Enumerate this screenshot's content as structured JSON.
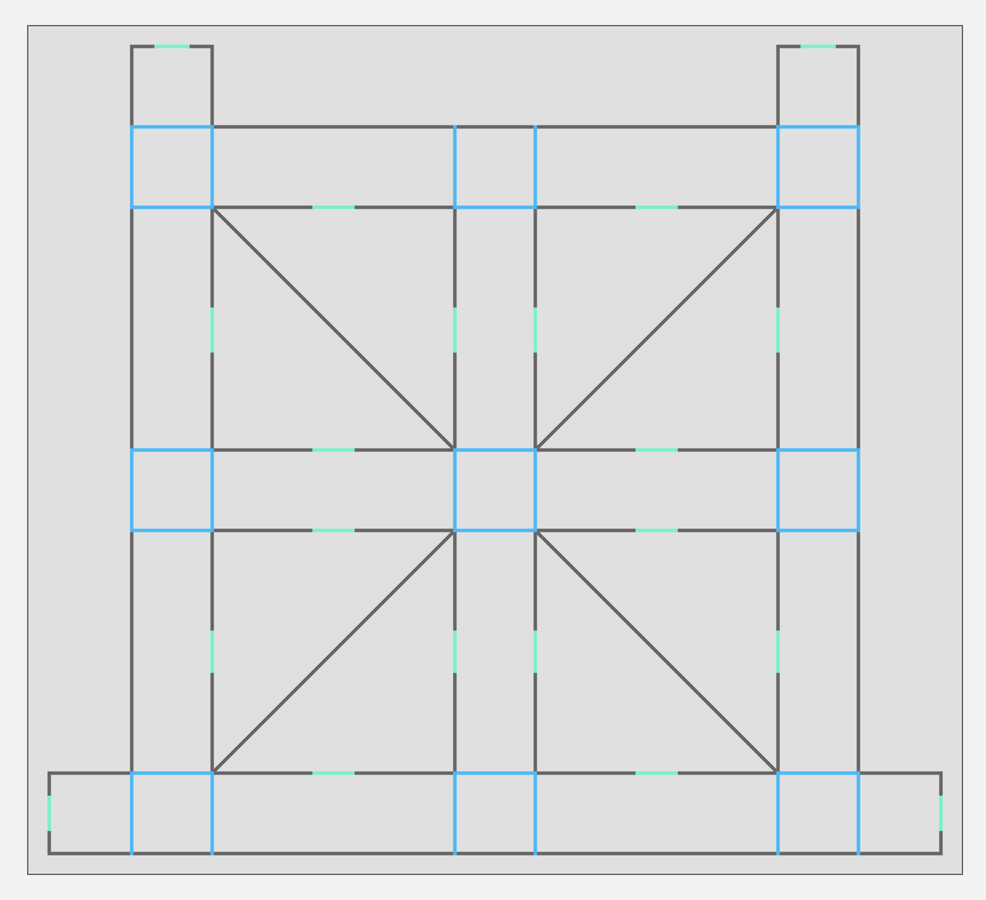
{
  "colors": {
    "page_background": "#f2f2f2",
    "canvas_fill": "#e0e0e0",
    "canvas_border": "#6b6b6b",
    "wall": "#666666",
    "connection": "#4db8f7",
    "opening": "#7af2c4"
  },
  "legend_semantics": {
    "wall": "wall-segment",
    "connection": "wall-junction",
    "opening": "door-opening"
  }
}
